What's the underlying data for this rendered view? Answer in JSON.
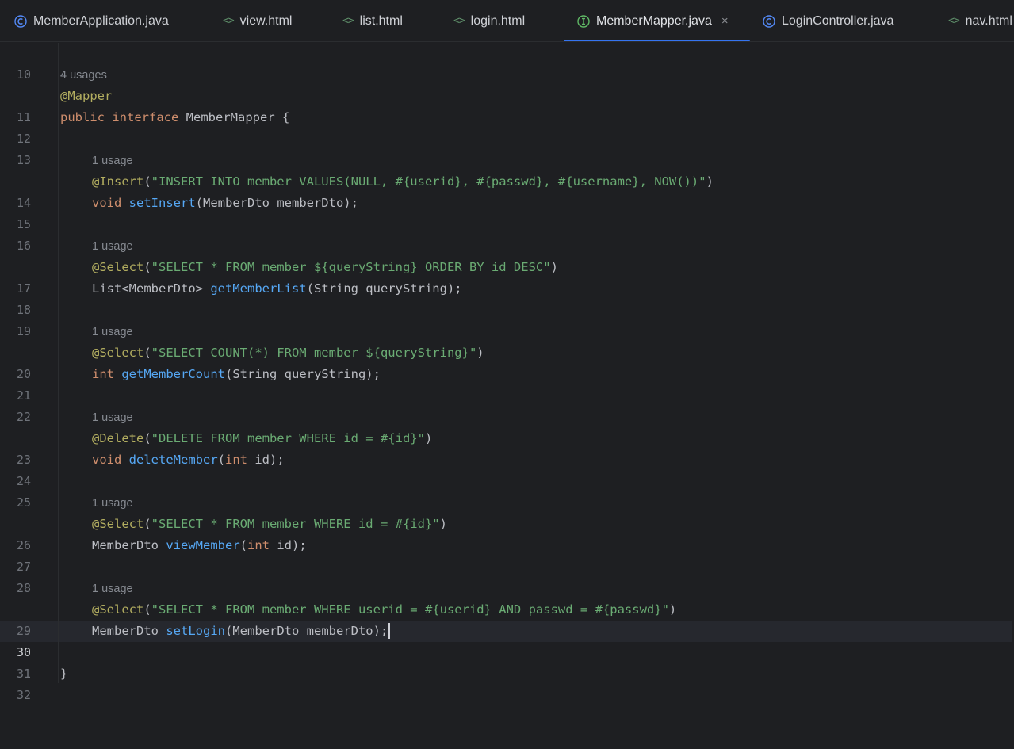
{
  "tabs": [
    {
      "label": "MemberApplication.java",
      "icon": "class-c-icon"
    },
    {
      "label": "view.html",
      "icon": "html-tag-icon"
    },
    {
      "label": "list.html",
      "icon": "html-tag-icon"
    },
    {
      "label": "login.html",
      "icon": "html-tag-icon"
    },
    {
      "label": "MemberMapper.java",
      "icon": "interface-i-icon",
      "active": true,
      "close": "×"
    },
    {
      "label": "LoginController.java",
      "icon": "class-c-icon"
    },
    {
      "label": "nav.html",
      "icon": "html-tag-icon"
    }
  ],
  "editor": {
    "line_numbers": [
      "10",
      "11",
      "12",
      "13",
      "14",
      "15",
      "16",
      "17",
      "18",
      "19",
      "20",
      "21",
      "22",
      "23",
      "24",
      "25",
      "26",
      "27",
      "28",
      "29",
      "30",
      "31",
      "32"
    ],
    "current_line": "30",
    "hints": {
      "h11": "4 usages",
      "h14": "1 usage",
      "h17": "1 usage",
      "h20": "1 usage",
      "h23": "1 usage",
      "h26": "1 usage",
      "h29": "1 usage"
    },
    "lines": {
      "l11": {
        "ann": "@Mapper"
      },
      "l12": {
        "kw1": "public",
        "kw2": "interface",
        "rest": " MemberMapper {"
      },
      "l14": {
        "ann": "@Insert",
        "open": "(",
        "str": "\"INSERT INTO member VALUES(NULL, #{userid}, #{passwd}, #{username}, NOW())\"",
        "close": ")"
      },
      "l15": {
        "kw": "void",
        "fn": "setInsert",
        "rest": "(MemberDto memberDto);"
      },
      "l17": {
        "ann": "@Select",
        "open": "(",
        "str": "\"SELECT * FROM member ${queryString} ORDER BY id DESC\"",
        "close": ")"
      },
      "l18": {
        "type": "List<MemberDto>",
        "fn": "getMemberList",
        "rest": "(String queryString);"
      },
      "l20": {
        "ann": "@Select",
        "open": "(",
        "str": "\"SELECT COUNT(*) FROM member ${queryString}\"",
        "close": ")"
      },
      "l21": {
        "kw": "int",
        "fn": "getMemberCount",
        "rest": "(String queryString);"
      },
      "l23": {
        "ann": "@Delete",
        "open": "(",
        "str": "\"DELETE FROM member WHERE id = #{id}\"",
        "close": ")"
      },
      "l24": {
        "kw": "void",
        "fn": "deleteMember",
        "p1": "(",
        "kw2": "int",
        "rest": " id);"
      },
      "l26": {
        "ann": "@Select",
        "open": "(",
        "str": "\"SELECT * FROM member WHERE id = #{id}\"",
        "close": ")"
      },
      "l27": {
        "type": "MemberDto",
        "fn": "viewMember",
        "p1": "(",
        "kw2": "int",
        "rest": " id);"
      },
      "l29": {
        "ann": "@Select",
        "open": "(",
        "str": "\"SELECT * FROM member WHERE userid = #{userid} AND passwd = #{passwd}\"",
        "close": ")"
      },
      "l30": {
        "type": "MemberDto",
        "fn": "setLogin",
        "rest": "(MemberDto memberDto);"
      },
      "l32": {
        "rest": "}"
      }
    }
  }
}
